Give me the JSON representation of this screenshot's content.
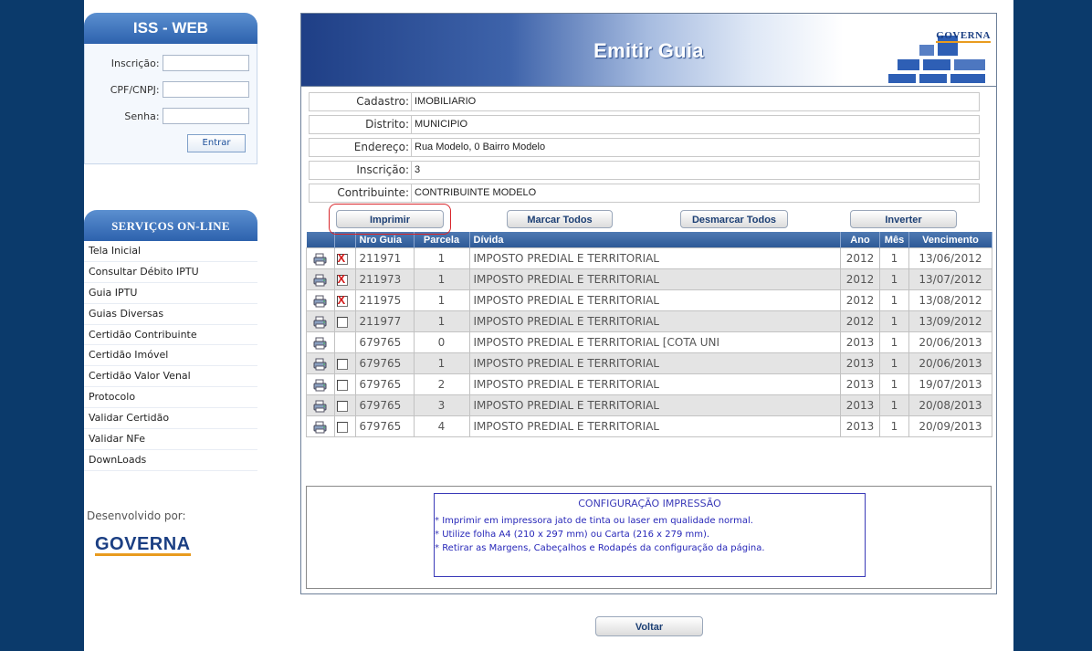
{
  "sidebar": {
    "title": "ISS - WEB",
    "login": {
      "inscricao_label": "Inscrição:",
      "cpf_label": "CPF/CNPJ:",
      "senha_label": "Senha:",
      "entrar_label": "Entrar"
    },
    "services_title": "SERVIÇOS ON-LINE",
    "items": [
      "Tela Inicial",
      "Consultar Débito IPTU",
      "Guia IPTU",
      "Guias Diversas",
      "Certidão Contribuinte",
      "Certidão Imóvel",
      "Certidão Valor Venal",
      "Protocolo",
      "Validar Certidão",
      "Validar NFe",
      "DownLoads"
    ],
    "developed_by": "Desenvolvido por:",
    "logo_text": "GOVERNA"
  },
  "header": {
    "title": "Emitir Guia",
    "logo_text": "GOVERNA"
  },
  "info": {
    "cadastro_label": "Cadastro:",
    "cadastro": "IMOBILIARIO",
    "distrito_label": "Distrito:",
    "distrito": "MUNICIPIO",
    "endereco_label": "Endereço:",
    "endereco": "Rua Modelo, 0 Bairro Modelo",
    "inscricao_label": "Inscrição:",
    "inscricao": "3",
    "contribuinte_label": "Contribuinte:",
    "contribuinte": "CONTRIBUINTE MODELO"
  },
  "actions": {
    "imprimir": "Imprimir",
    "marcar_todos": "Marcar Todos",
    "desmarcar_todos": "Desmarcar Todos",
    "inverter": "Inverter"
  },
  "table": {
    "columns": [
      "Nro Guia",
      "Parcela",
      "Dívida",
      "Ano",
      "Mês",
      "Vencimento"
    ],
    "rows": [
      {
        "checkbox": "checked",
        "nro": "211971",
        "parcela": "1",
        "divida": "IMPOSTO PREDIAL E TERRITORIAL",
        "ano": "2012",
        "mes": "1",
        "vencimento": "13/06/2012"
      },
      {
        "checkbox": "checked",
        "nro": "211973",
        "parcela": "1",
        "divida": "IMPOSTO PREDIAL E TERRITORIAL",
        "ano": "2012",
        "mes": "1",
        "vencimento": "13/07/2012"
      },
      {
        "checkbox": "checked",
        "nro": "211975",
        "parcela": "1",
        "divida": "IMPOSTO PREDIAL E TERRITORIAL",
        "ano": "2012",
        "mes": "1",
        "vencimento": "13/08/2012"
      },
      {
        "checkbox": "unchecked",
        "nro": "211977",
        "parcela": "1",
        "divida": "IMPOSTO PREDIAL E TERRITORIAL",
        "ano": "2012",
        "mes": "1",
        "vencimento": "13/09/2012"
      },
      {
        "checkbox": "none",
        "nro": "679765",
        "parcela": "0",
        "divida": "IMPOSTO PREDIAL E TERRITORIAL [COTA UNI",
        "ano": "2013",
        "mes": "1",
        "vencimento": "20/06/2013"
      },
      {
        "checkbox": "unchecked",
        "nro": "679765",
        "parcela": "1",
        "divida": "IMPOSTO PREDIAL E TERRITORIAL",
        "ano": "2013",
        "mes": "1",
        "vencimento": "20/06/2013"
      },
      {
        "checkbox": "unchecked",
        "nro": "679765",
        "parcela": "2",
        "divida": "IMPOSTO PREDIAL E TERRITORIAL",
        "ano": "2013",
        "mes": "1",
        "vencimento": "19/07/2013"
      },
      {
        "checkbox": "unchecked",
        "nro": "679765",
        "parcela": "3",
        "divida": "IMPOSTO PREDIAL E TERRITORIAL",
        "ano": "2013",
        "mes": "1",
        "vencimento": "20/08/2013"
      },
      {
        "checkbox": "unchecked",
        "nro": "679765",
        "parcela": "4",
        "divida": "IMPOSTO PREDIAL E TERRITORIAL",
        "ano": "2013",
        "mes": "1",
        "vencimento": "20/09/2013"
      }
    ]
  },
  "config": {
    "title": "CONFIGURAÇÃO IMPRESSÃO",
    "lines": [
      "Imprimir em impressora jato de tinta ou laser em qualidade normal.",
      "Utilize folha A4 (210 x 297 mm) ou Carta (216 x 279 mm).",
      "Retirar as Margens, Cabeçalhos e Rodapés da configuração da página."
    ],
    "bullet": "*"
  },
  "voltar_label": "Voltar",
  "colors": {
    "outer_bg": "#0b3a6b",
    "header_blue": "#2e5a97",
    "highlight_red": "#d8262b",
    "config_text": "#2626b8"
  }
}
